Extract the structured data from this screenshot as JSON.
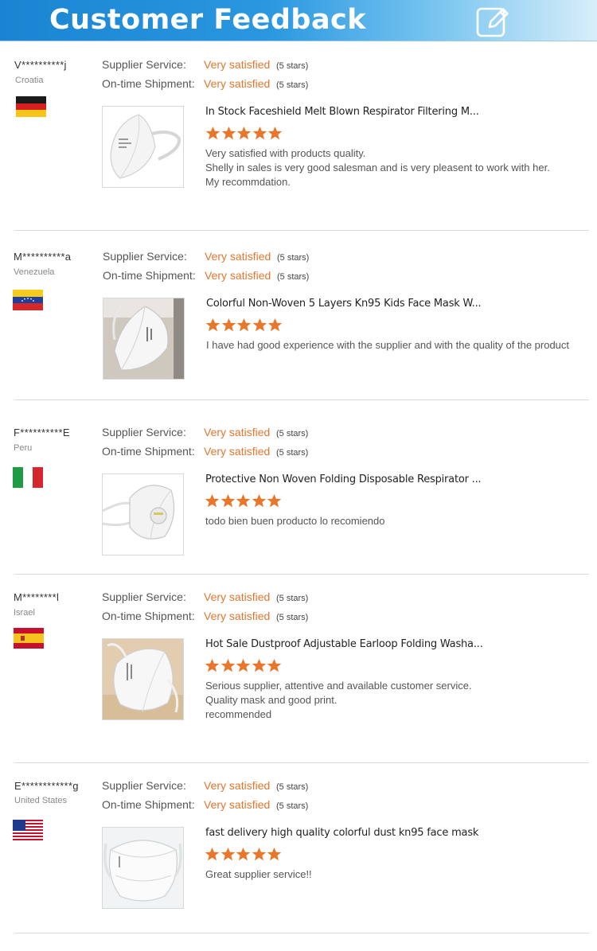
{
  "header": {
    "title": "Customer Feedback",
    "icon": "edit-icon"
  },
  "labels": {
    "supplier_service": "Supplier Service:",
    "ontime_shipment": "On-time Shipment:"
  },
  "colors": {
    "accent": "#e2772f",
    "banner": "#1a84d2",
    "star": "#e8762b"
  },
  "reviews": [
    {
      "buyer": "V**********j",
      "country": "Croatia",
      "flag": "germany-flag",
      "supplier_service": {
        "value": "Very satisfied",
        "stars": "(5 stars)"
      },
      "ontime_shipment": {
        "value": "Very satisfied",
        "stars": "(5 stars)"
      },
      "product": "In Stock Faceshield Melt Blown Respirator Filtering M...",
      "rating": 5,
      "comment": [
        "Very satisfied with  products  quality.",
        "Shelly in sales  is very good salesman and is very pleasent to work with her.",
        "My recommdation."
      ]
    },
    {
      "buyer": "M**********a",
      "country": "Venezuela",
      "flag": "venezuela-flag",
      "supplier_service": {
        "value": "Very satisfied",
        "stars": "(5 stars)"
      },
      "ontime_shipment": {
        "value": "Very satisfied",
        "stars": "(5 stars)"
      },
      "product": "Colorful Non-Woven 5 Layers Kn95 Kids Face Mask W...",
      "rating": 5,
      "comment": [
        "I have had good experience with the supplier and with the quality of the product"
      ]
    },
    {
      "buyer": "F**********E",
      "country": "Peru",
      "flag": "italy-flag",
      "supplier_service": {
        "value": "Very satisfied",
        "stars": "(5 stars)"
      },
      "ontime_shipment": {
        "value": "Very satisfied",
        "stars": "(5 stars)"
      },
      "product": "Protective Non Woven Folding Disposable Respirator ...",
      "rating": 5,
      "comment": [
        "todo bien buen producto lo recomiendo"
      ]
    },
    {
      "buyer": "M********l",
      "country": "Israel",
      "flag": "spain-flag",
      "supplier_service": {
        "value": "Very satisfied",
        "stars": "(5 stars)"
      },
      "ontime_shipment": {
        "value": "Very satisfied",
        "stars": "(5 stars)"
      },
      "product": "Hot Sale Dustproof Adjustable Earloop Folding Washa...",
      "rating": 5,
      "comment": [
        "Serious supplier, attentive and available customer service.",
        "Quality mask and good print.",
        "recommended"
      ]
    },
    {
      "buyer": "E************g",
      "country": "United States",
      "flag": "usa-flag",
      "supplier_service": {
        "value": "Very satisfied",
        "stars": "(5 stars)"
      },
      "ontime_shipment": {
        "value": "Very satisfied",
        "stars": "(5 stars)"
      },
      "product": "fast delivery high quality colorful dust kn95 face mask",
      "rating": 5,
      "comment": [
        "Great supplier service!!"
      ]
    }
  ]
}
